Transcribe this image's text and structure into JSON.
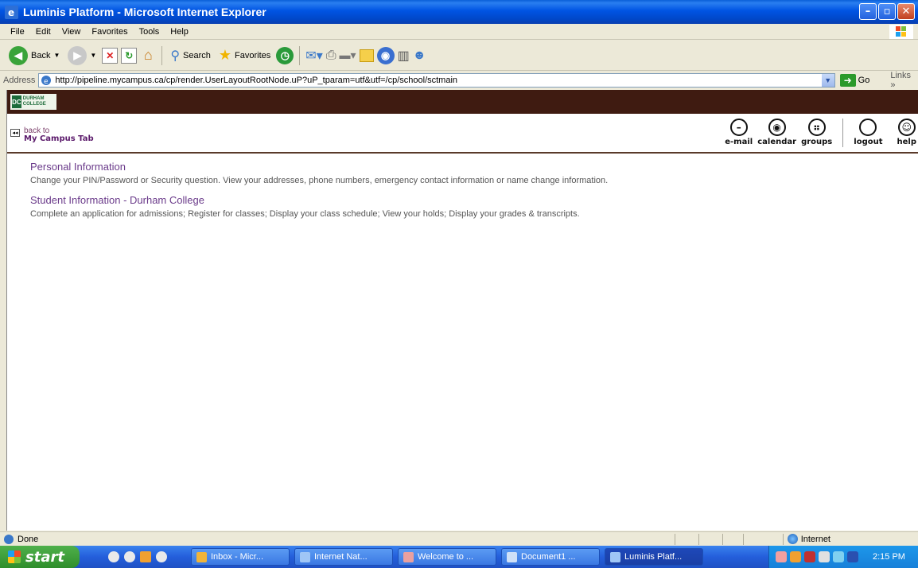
{
  "window": {
    "title": "Luminis Platform - Microsoft Internet Explorer"
  },
  "menu": [
    "File",
    "Edit",
    "View",
    "Favorites",
    "Tools",
    "Help"
  ],
  "toolbar": {
    "back": "Back",
    "search": "Search",
    "favorites": "Favorites"
  },
  "address": {
    "label": "Address",
    "url": "http://pipeline.mycampus.ca/cp/render.UserLayoutRootNode.uP?uP_tparam=utf&utf=/cp/school/sctmain",
    "go": "Go",
    "links": "Links"
  },
  "brand": {
    "logo_text": "DURHAM COLLEGE"
  },
  "nav": {
    "back_line1": "back to",
    "back_line2": "My Campus Tab",
    "icons": [
      {
        "label": "e-mail",
        "icon": "email-icon"
      },
      {
        "label": "calendar",
        "icon": "calendar-icon"
      },
      {
        "label": "groups",
        "icon": "groups-icon"
      },
      {
        "label": "logout",
        "icon": "logout-icon"
      },
      {
        "label": "help",
        "icon": "help-icon"
      }
    ]
  },
  "sections": [
    {
      "title": "Personal Information",
      "desc": "Change your PIN/Password or Security question. View your addresses, phone numbers, emergency contact information or name change information."
    },
    {
      "title": "Student Information - Durham College",
      "desc": "Complete an application for admissions; Register for classes; Display your class schedule; View your holds; Display your grades & transcripts."
    }
  ],
  "status": {
    "text": "Done",
    "zone": "Internet"
  },
  "taskbar": {
    "start": "start",
    "tasks": [
      "Inbox - Micr...",
      "Internet Nat...",
      "Welcome to ...",
      "Document1 ...",
      "Luminis Platf..."
    ],
    "active_task": 4,
    "clock": "2:15 PM"
  }
}
